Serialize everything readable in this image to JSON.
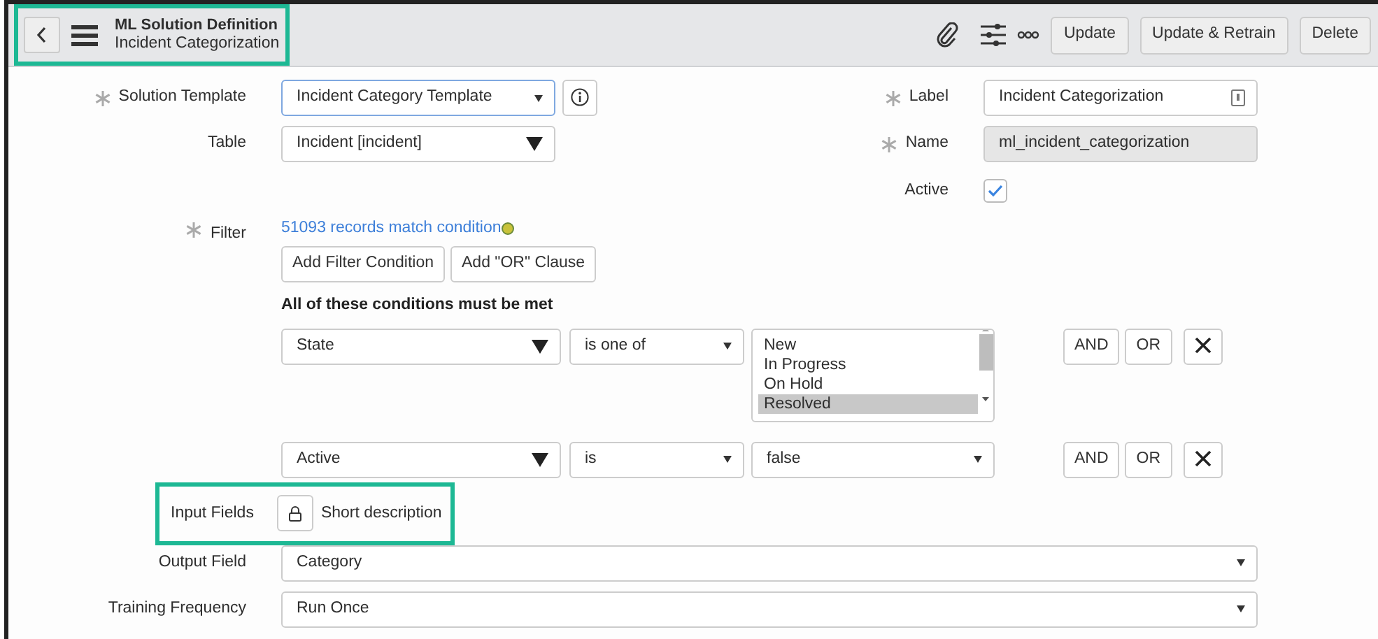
{
  "header": {
    "title": "ML Solution Definition",
    "subtitle": "Incident Categorization",
    "highlighted": true,
    "buttons": [
      "Update",
      "Update & Retrain",
      "Delete"
    ]
  },
  "left_fields": [
    {
      "kind": "dropdown",
      "label": "Solution Template",
      "required": true,
      "value": "Incident Category Template",
      "info": true
    },
    {
      "kind": "picker",
      "label": "Table",
      "required": false,
      "value": "Incident [incident]",
      "info": false
    }
  ],
  "right_fields": [
    {
      "kind": "text",
      "label": "Label",
      "required": true,
      "value": "Incident Categorization"
    },
    {
      "kind": "readonly",
      "label": "Name",
      "required": true,
      "value": "ml_incident_categorization"
    },
    {
      "kind": "checkbox",
      "label": "Active",
      "required": false,
      "checked": true
    }
  ],
  "filter": {
    "label": "Filter",
    "required": true,
    "match_text": "51093 records match condition",
    "buttons": [
      "Add Filter Condition",
      "Add \"OR\" Clause"
    ],
    "heading": "All of these conditions must be met",
    "conditions": [
      {
        "field": "State",
        "operator": "is one of",
        "kind": "list",
        "options": [
          {
            "text": "New",
            "selected": false
          },
          {
            "text": "In Progress",
            "selected": false
          },
          {
            "text": "On Hold",
            "selected": false
          },
          {
            "text": "Resolved",
            "selected": true
          }
        ],
        "buttons": [
          "AND",
          "OR"
        ]
      },
      {
        "field": "Active",
        "operator": "is",
        "kind": "select",
        "value": "false",
        "buttons": [
          "AND",
          "OR"
        ]
      }
    ]
  },
  "input_fields": {
    "label": "Input Fields",
    "value": "Short description",
    "highlighted": true
  },
  "bottom_fields": [
    {
      "label": "Output Field",
      "value": "Category"
    },
    {
      "label": "Training Frequency",
      "value": "Run Once"
    }
  ]
}
